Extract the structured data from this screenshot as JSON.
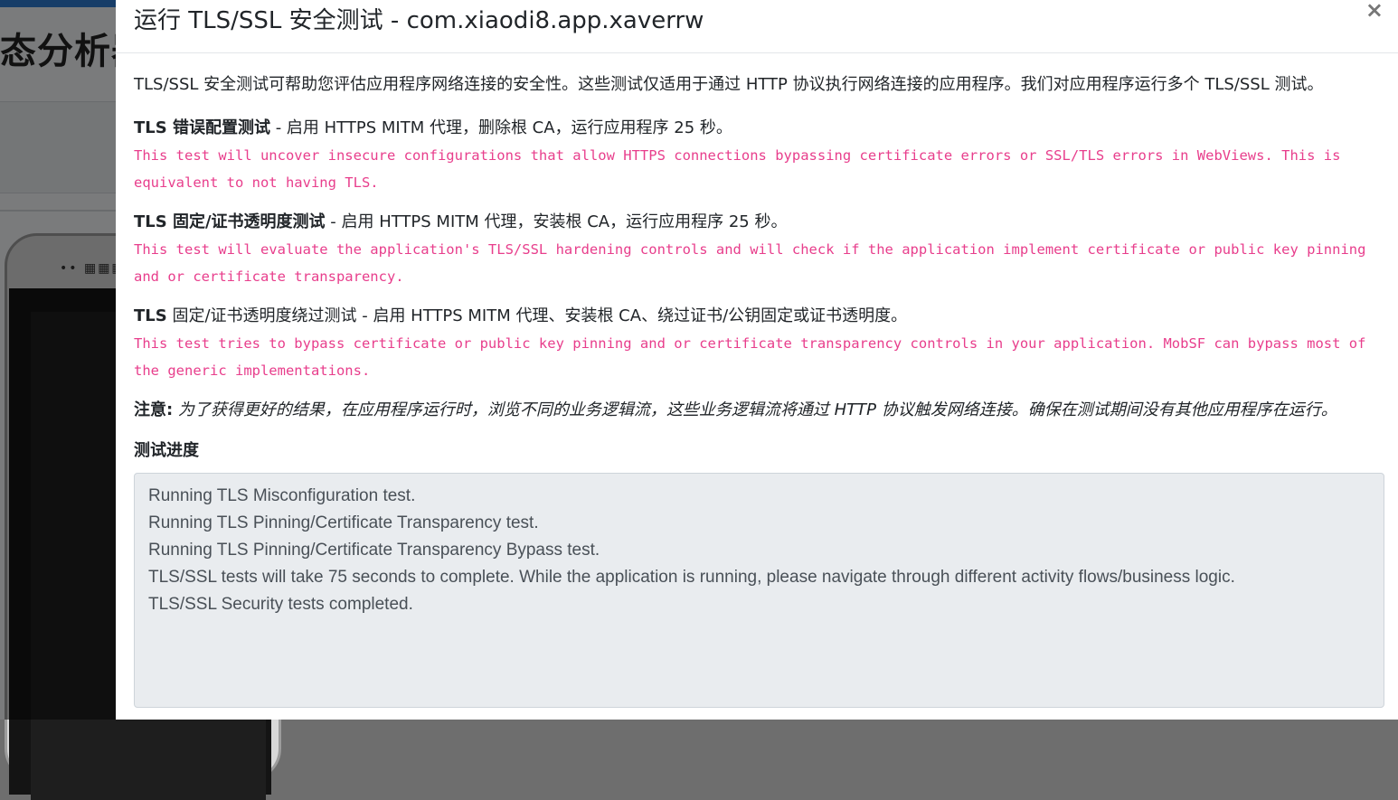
{
  "background": {
    "title_fragment": "态分析器",
    "phone_status": "•• ▦▦▦"
  },
  "modal": {
    "title": "运行 TLS/SSL 安全测试 - com.xiaodi8.app.xaverrw",
    "close_label": "×",
    "intro": "TLS/SSL 安全测试可帮助您评估应用程序网络连接的安全性。这些测试仅适用于通过 HTTP 协议执行网络连接的应用程序。我们对应用程序运行多个 TLS/SSL 测试。",
    "tests": [
      {
        "name": "TLS 错误配置测试",
        "detail": " - 启用 HTTPS MITM 代理，删除根 CA，运行应用程序 25 秒。",
        "description": "This test will uncover insecure configurations that allow HTTPS connections bypassing certificate errors or SSL/TLS errors in WebViews. This is equivalent to not having TLS."
      },
      {
        "name": "TLS 固定/证书透明度测试",
        "detail": " - 启用 HTTPS MITM 代理，安装根 CA，运行应用程序 25 秒。",
        "description": "This test will evaluate the application's TLS/SSL hardening controls and will check if the application implement certificate or public key pinning and or certificate transparency."
      },
      {
        "name": "TLS",
        "detail": " 固定/证书透明度绕过测试 - 启用 HTTPS MITM 代理、安装根 CA、绕过证书/公钥固定或证书透明度。",
        "description": "This test tries to bypass certificate or public key pinning and or certificate transparency controls in your application. MobSF can bypass most of the generic implementations."
      }
    ],
    "note_label": "注意:",
    "note_text": " 为了获得更好的结果，在应用程序运行时，浏览不同的业务逻辑流，这些业务逻辑流将通过 HTTP 协议触发网络连接。确保在测试期间没有其他应用程序在运行。",
    "progress_title": "测试进度",
    "progress_log": [
      "Running TLS Misconfiguration test.",
      "Running TLS Pinning/Certificate Transparency test.",
      "Running TLS Pinning/Certificate Transparency Bypass test.",
      "TLS/SSL tests will take 75 seconds to complete. While the application is running, please navigate through different activity flows/business logic.",
      "TLS/SSL Security tests completed."
    ]
  },
  "colors": {
    "accent_blue": "#2f7bd1",
    "description_pink": "#e83e8c",
    "log_background": "#e9ecef"
  }
}
